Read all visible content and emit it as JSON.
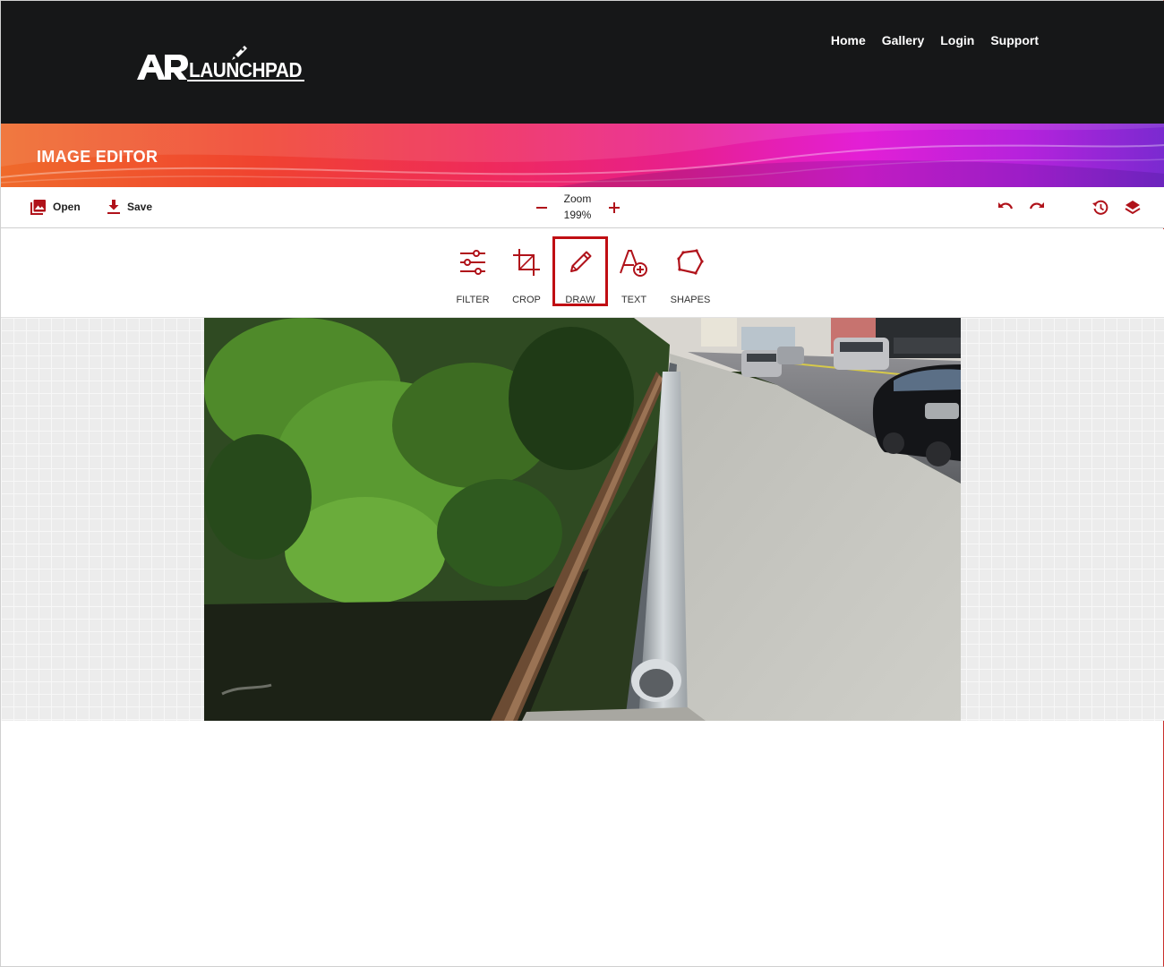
{
  "header": {
    "logo_text": "AR LAUNCHPAD",
    "nav": [
      {
        "label": "Home"
      },
      {
        "label": "Gallery"
      },
      {
        "label": "Login"
      },
      {
        "label": "Support"
      }
    ]
  },
  "banner": {
    "title": "IMAGE EDITOR"
  },
  "toolbar": {
    "open_label": "Open",
    "save_label": "Save",
    "zoom_label": "Zoom",
    "zoom_value": "199%"
  },
  "tools": [
    {
      "label": "FILTER",
      "icon": "sliders-icon"
    },
    {
      "label": "CROP",
      "icon": "crop-icon"
    },
    {
      "label": "DRAW",
      "icon": "pencil-icon",
      "selected": true
    },
    {
      "label": "TEXT",
      "icon": "text-add-icon"
    },
    {
      "label": "SHAPES",
      "icon": "polygon-icon"
    }
  ],
  "colors": {
    "accent": "#c00e13",
    "header_bg": "#161718",
    "banner_start": "#ef6a2b",
    "banner_end": "#7a2ad0"
  }
}
